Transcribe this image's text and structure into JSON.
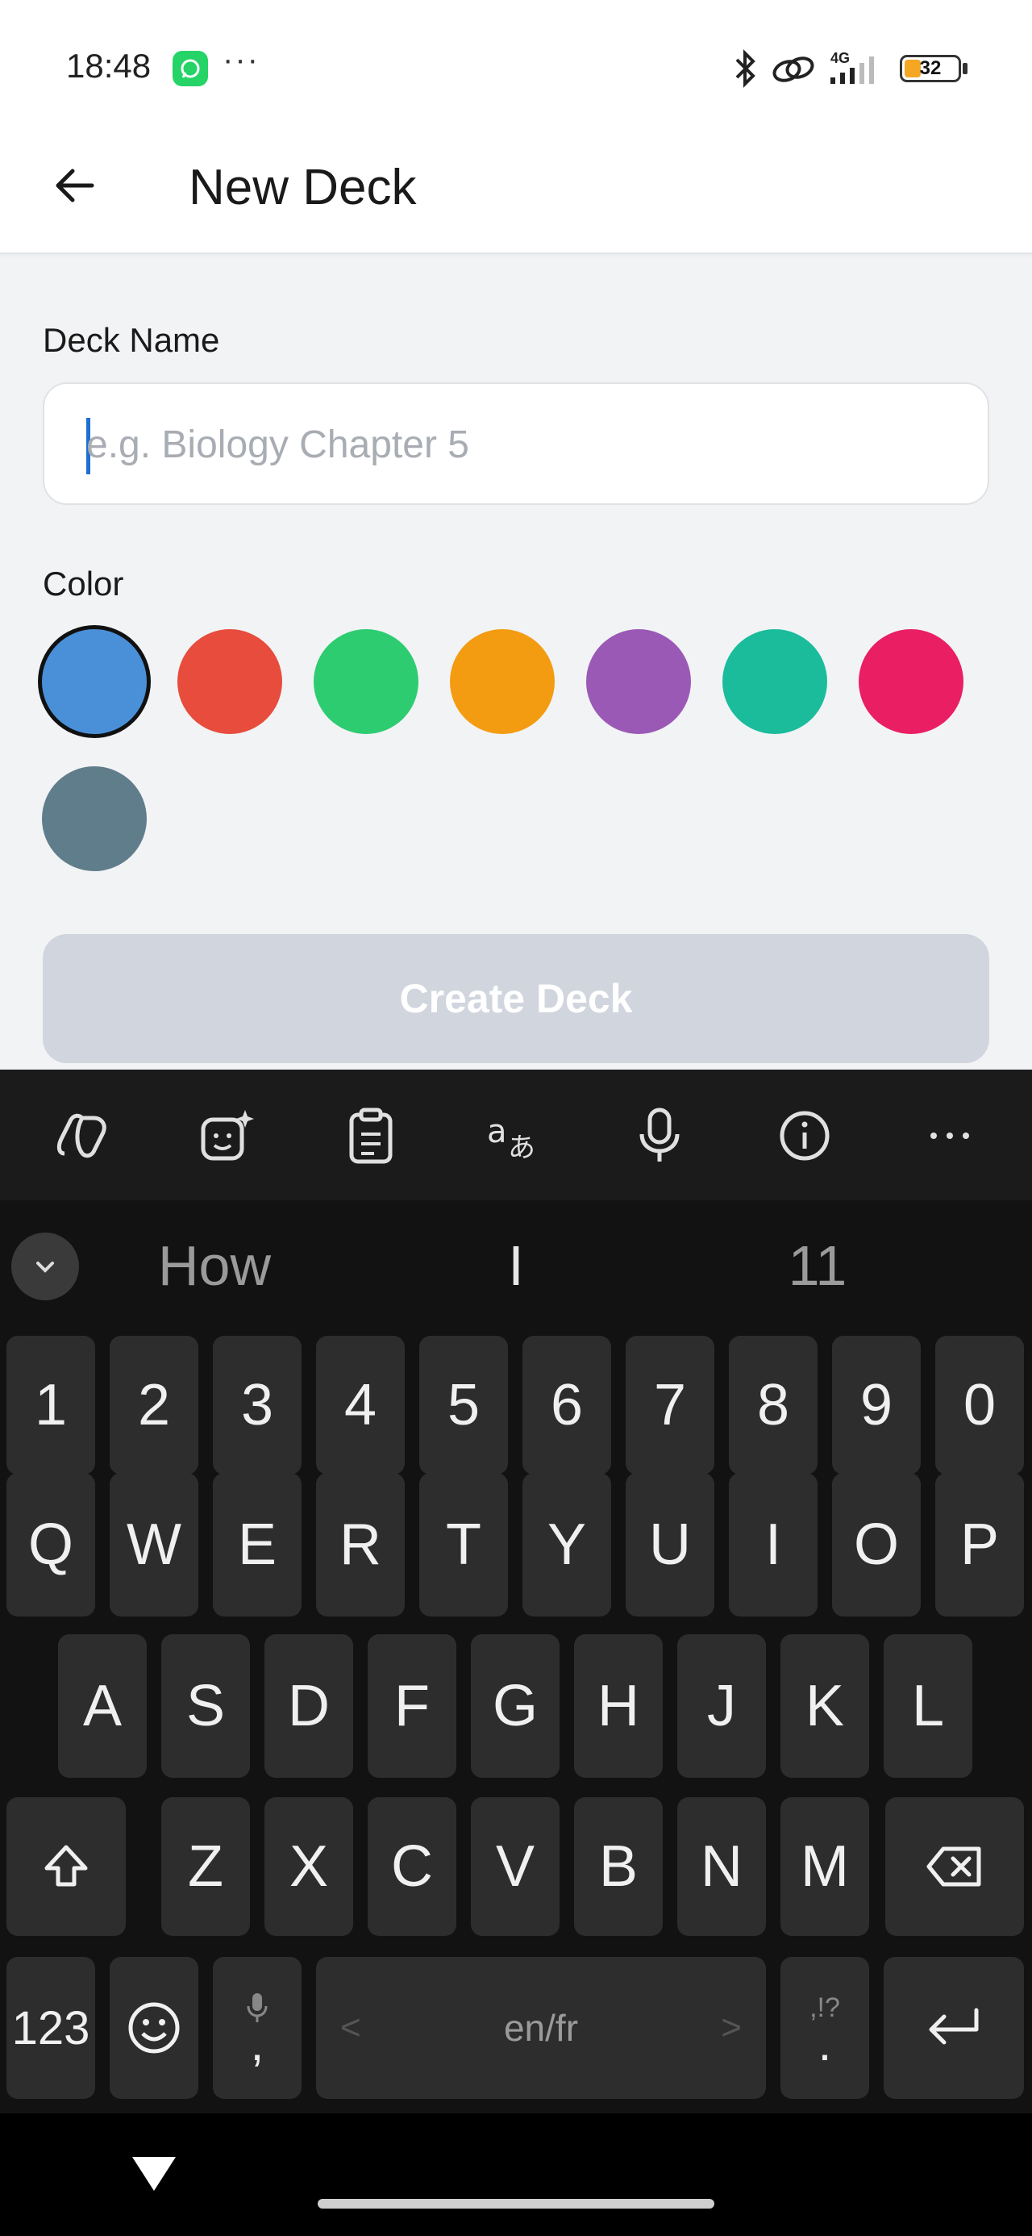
{
  "status_bar": {
    "time": "18:48",
    "more": "···",
    "battery": "32",
    "battery_level": 0.32,
    "network": "4G",
    "icons": [
      "whatsapp-icon",
      "bluetooth-icon",
      "link-icon",
      "signal-icon",
      "battery-icon"
    ]
  },
  "header": {
    "title": "New Deck",
    "back_icon": "arrow-left-icon"
  },
  "form": {
    "name_label": "Deck Name",
    "name_placeholder": "e.g. Biology Chapter 5",
    "name_value": "",
    "color_label": "Color",
    "colors": [
      "#4a90d9",
      "#e74c3c",
      "#2ecc71",
      "#f39c12",
      "#9b59b6",
      "#1abc9c",
      "#e91e63",
      "#607d8b"
    ],
    "selected_color_index": 0,
    "submit_label": "Create Deck"
  },
  "keyboard": {
    "toolbar_icons": [
      "copilot-icon",
      "sticker-icon",
      "clipboard-icon",
      "translate-icon",
      "microphone-icon",
      "info-icon",
      "more-icon"
    ],
    "suggestions": [
      "How",
      "I",
      "11"
    ],
    "number_row": [
      "1",
      "2",
      "3",
      "4",
      "5",
      "6",
      "7",
      "8",
      "9",
      "0"
    ],
    "row1": [
      "Q",
      "W",
      "E",
      "R",
      "T",
      "Y",
      "U",
      "I",
      "O",
      "P"
    ],
    "row2": [
      "A",
      "S",
      "D",
      "F",
      "G",
      "H",
      "J",
      "K",
      "L"
    ],
    "row3": [
      "Z",
      "X",
      "C",
      "V",
      "B",
      "N",
      "M"
    ],
    "numbers_key": "123",
    "comma_key": ",",
    "space_label": "en/fr",
    "space_left": "<",
    "space_right": ">",
    "punct_top": ",!?",
    "punct_key": "."
  },
  "nav": {
    "back_icon": "triangle-down-icon"
  }
}
